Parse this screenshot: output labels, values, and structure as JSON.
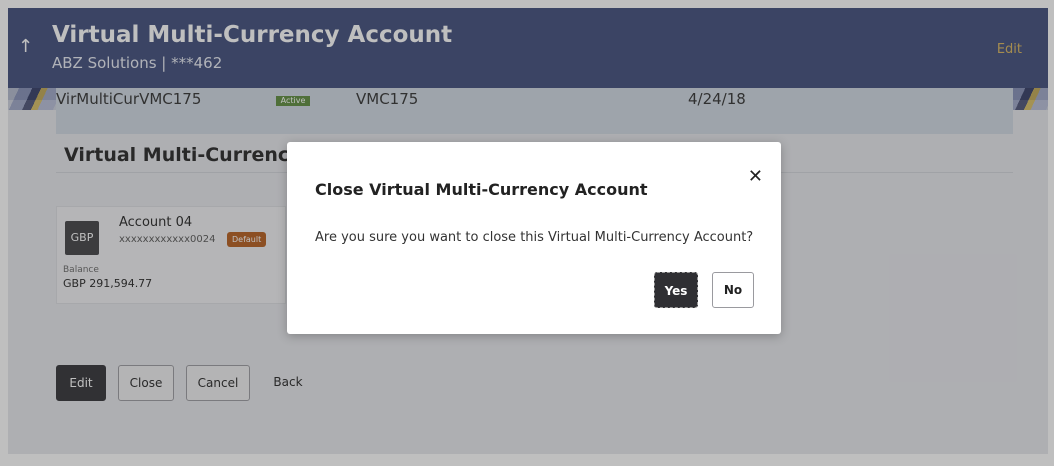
{
  "header": {
    "title": "Virtual Multi-Currency Account",
    "subtitle": "ABZ Solutions | ***462",
    "edit_label": "Edit"
  },
  "summary_row": {
    "account_id": "VirMultiCurVMC175",
    "status": "Active",
    "code": "VMC175",
    "date": "4/24/18"
  },
  "section": {
    "title": "Virtual Multi-Currency A"
  },
  "account_card": {
    "currency": "GBP",
    "name": "Account 04",
    "number": "xxxxxxxxxxxx0024",
    "badge": "Default",
    "balance_label": "Balance",
    "balance_value": "GBP 291,594.77"
  },
  "actions": {
    "edit": "Edit",
    "close": "Close",
    "cancel": "Cancel",
    "back": "Back"
  },
  "dialog": {
    "title": "Close Virtual Multi-Currency Account",
    "message": "Are you sure you want to close this Virtual Multi-Currency Account?",
    "close_symbol": "✕",
    "yes_label": "Yes",
    "no_label": "No"
  },
  "icons": {
    "back": "arrow-up-icon",
    "close": "close-icon"
  },
  "colors": {
    "header_bg": "#3d4b79",
    "accent": "#d9b45a",
    "primary_button": "#2f2f33",
    "default_badge": "#b45a1a"
  }
}
